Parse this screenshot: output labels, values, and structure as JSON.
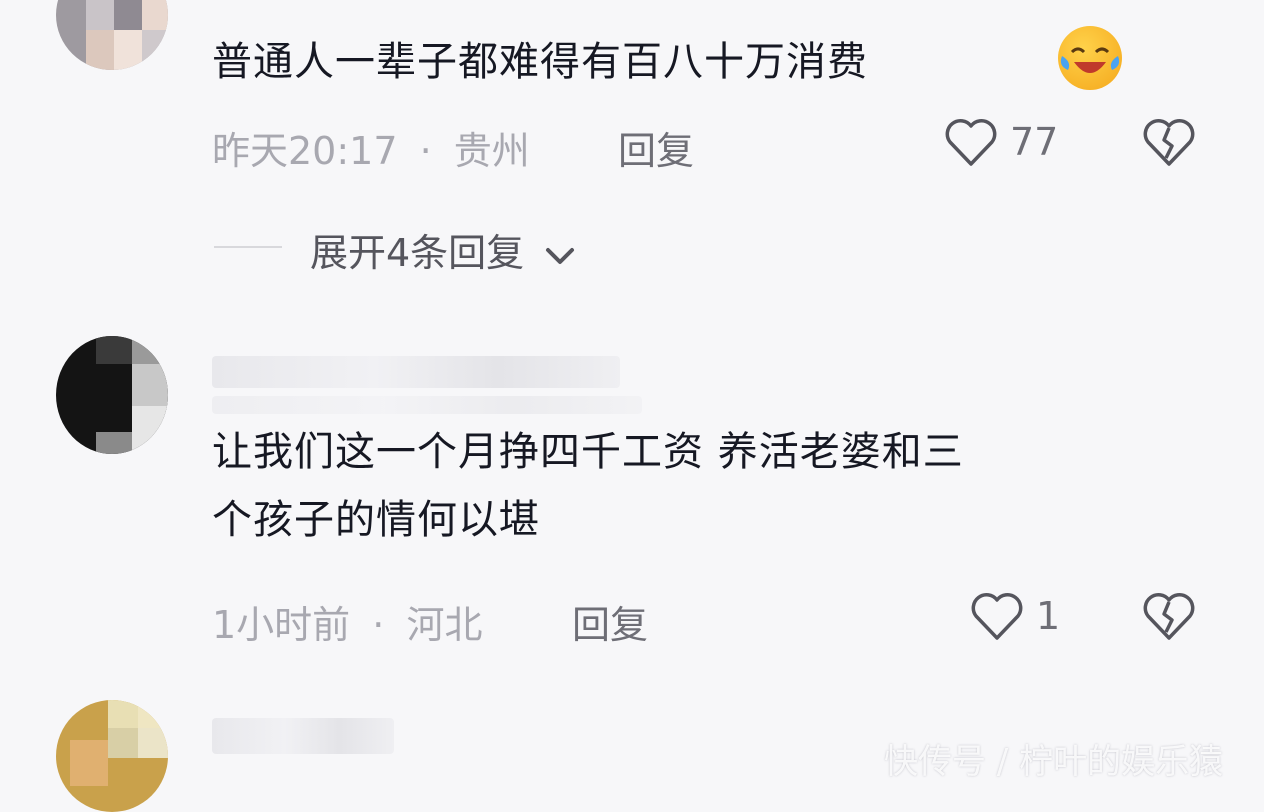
{
  "comments": [
    {
      "text": "普通人一辈子都难得有百八十万消费",
      "time": "昨天20:17",
      "location": "贵州",
      "reply_label": "回复",
      "likes": "77",
      "expand_label": "展开4条回复"
    },
    {
      "text": "让我们这一个月挣四千工资 养活老婆和三个孩子的情何以堪",
      "line1": "让我们这一个月挣四千工资 养活老婆和三",
      "line2": "个孩子的情何以堪",
      "time": "1小时前",
      "location": "河北",
      "reply_label": "回复",
      "likes": "1"
    }
  ],
  "separator": "·",
  "watermark": "快传号 / 柠叶的娱乐猿",
  "icons": {
    "emoji": "laughing-tears-emoji",
    "like": "heart-outline-icon",
    "dislike": "broken-heart-icon",
    "expand": "chevron-down-icon"
  },
  "colors": {
    "background": "#f7f7f9",
    "text": "#161823",
    "meta": "#a8a8b0",
    "action": "#6e6e76"
  }
}
